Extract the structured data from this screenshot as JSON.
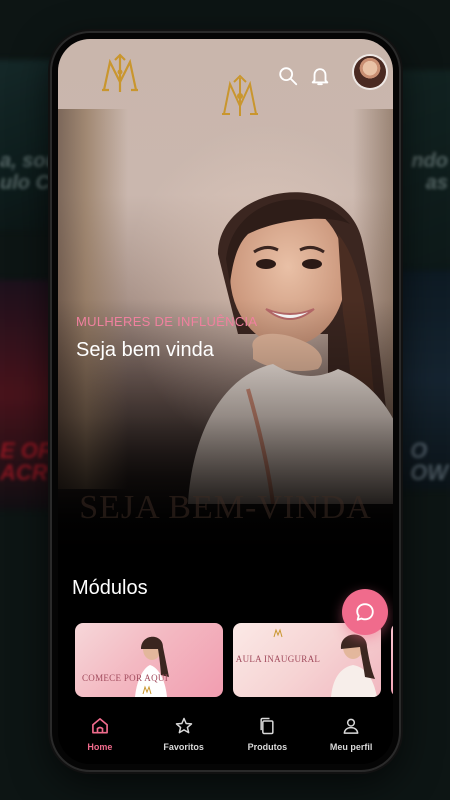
{
  "background": {
    "promo_left_top": "a, sou\nulo Co",
    "promo_right_top": "ndo\nas",
    "promo_left_bottom": "E OF\nACR",
    "promo_right_bottom": "O\nOW"
  },
  "header": {
    "search_icon": "search-icon",
    "notifications_icon": "bell-icon"
  },
  "hero": {
    "eyebrow": "MULHERES DE INFLUÊNCIA",
    "title": "Seja bem vinda",
    "banner_text": "SEJA BEM-VINDA"
  },
  "modules": {
    "title": "Módulos",
    "cards": [
      {
        "label": "COMECE POR AQUI"
      },
      {
        "label": "AULA INAUGURAL"
      }
    ]
  },
  "chat_button": {
    "icon": "chat-bubble-icon"
  },
  "nav": {
    "items": [
      {
        "label": "Home",
        "icon": "home-icon",
        "active": true
      },
      {
        "label": "Favoritos",
        "icon": "star-icon",
        "active": false
      },
      {
        "label": "Produtos",
        "icon": "copy-icon",
        "active": false
      },
      {
        "label": "Meu perfil",
        "icon": "user-icon",
        "active": false
      }
    ]
  },
  "colors": {
    "accent": "#f06b8c",
    "gold": "#c9962e",
    "background": "#000000"
  }
}
